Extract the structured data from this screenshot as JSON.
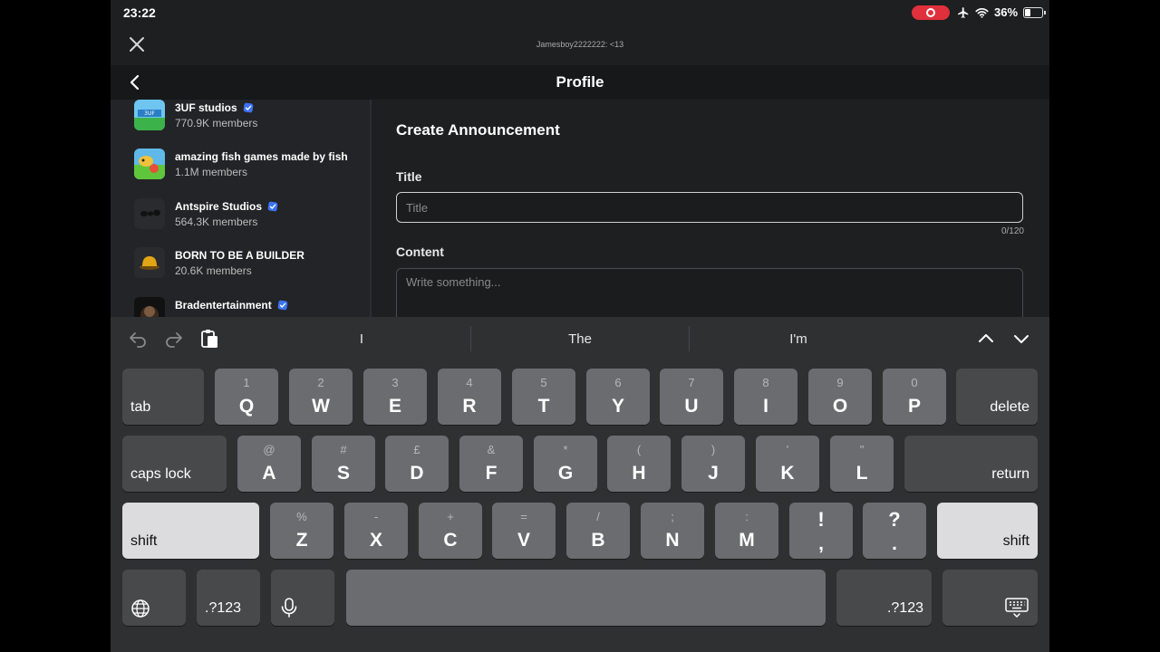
{
  "status": {
    "time": "23:22",
    "battery": "36%",
    "battery_level": 0.36
  },
  "window": {
    "title": "Jamesboy2222222: <13"
  },
  "nav": {
    "title": "Profile"
  },
  "sidebar": {
    "groups": [
      {
        "name": "3UF studios",
        "members": "770.9K members",
        "verified": true
      },
      {
        "name": "amazing fish games made by fish",
        "members": "1.1M members",
        "verified": false
      },
      {
        "name": "Antspire Studios",
        "members": "564.3K members",
        "verified": true
      },
      {
        "name": "BORN TO BE A BUILDER",
        "members": "20.6K members",
        "verified": false
      },
      {
        "name": "Bradentertainment",
        "members": "",
        "verified": true
      }
    ]
  },
  "form": {
    "heading": "Create Announcement",
    "title_label": "Title",
    "title_placeholder": "Title",
    "title_value": "",
    "char_count": "0/120",
    "content_label": "Content",
    "content_placeholder": "Write something..."
  },
  "keyboard": {
    "suggestions": [
      "I",
      "The",
      "I'm"
    ],
    "row1": {
      "tab": "tab",
      "keys": [
        {
          "main": "Q",
          "alt": "1"
        },
        {
          "main": "W",
          "alt": "2"
        },
        {
          "main": "E",
          "alt": "3"
        },
        {
          "main": "R",
          "alt": "4"
        },
        {
          "main": "T",
          "alt": "5"
        },
        {
          "main": "Y",
          "alt": "6"
        },
        {
          "main": "U",
          "alt": "7"
        },
        {
          "main": "I",
          "alt": "8"
        },
        {
          "main": "O",
          "alt": "9"
        },
        {
          "main": "P",
          "alt": "0"
        }
      ],
      "delete": "delete"
    },
    "row2": {
      "caps": "caps lock",
      "keys": [
        {
          "main": "A",
          "alt": "@"
        },
        {
          "main": "S",
          "alt": "#"
        },
        {
          "main": "D",
          "alt": "£"
        },
        {
          "main": "F",
          "alt": "&"
        },
        {
          "main": "G",
          "alt": "*"
        },
        {
          "main": "H",
          "alt": "("
        },
        {
          "main": "J",
          "alt": ")"
        },
        {
          "main": "K",
          "alt": "'"
        },
        {
          "main": "L",
          "alt": "\""
        }
      ],
      "return": "return"
    },
    "row3": {
      "shift": "shift",
      "keys": [
        {
          "main": "Z",
          "alt": "%"
        },
        {
          "main": "X",
          "alt": "-"
        },
        {
          "main": "C",
          "alt": "+"
        },
        {
          "main": "V",
          "alt": "="
        },
        {
          "main": "B",
          "alt": "/"
        },
        {
          "main": "N",
          "alt": ";"
        },
        {
          "main": "M",
          "alt": ":"
        },
        {
          "main": ",",
          "alt": "!"
        },
        {
          "main": ".",
          "alt": "?"
        }
      ]
    },
    "row4": {
      "numbers_left": ".?123",
      "numbers_right": ".?123"
    }
  },
  "colors": {
    "verified": "#3b73f5",
    "record": "#e0303b"
  }
}
